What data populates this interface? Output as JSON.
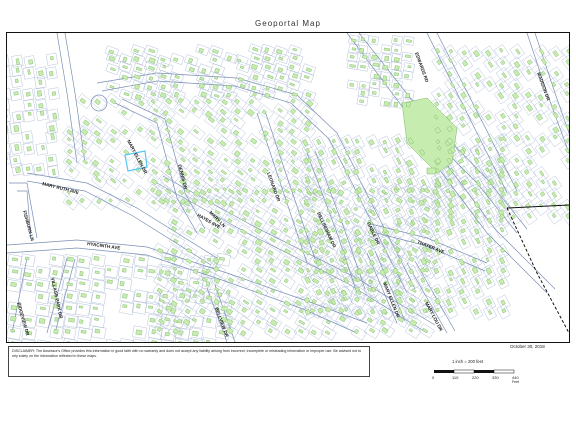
{
  "title": "Geoportal Map",
  "date": "October 30, 2018",
  "disclaimer": "DISCLAIMER: The Assessor's Office provides this information in good faith with no warranty and does not accept any liability arising from incorrect, incomplete or misleading information or improper use. Be advised not to rely solely on the information reflected in these maps.",
  "scale": {
    "text": "1 inch = 200 feet",
    "ticks": [
      "0",
      "110",
      "220",
      "330",
      "440"
    ],
    "unit": "Feet"
  },
  "streets": [
    {
      "key": "mary_ellen_dr",
      "name": "MARY ELLEN DR"
    },
    {
      "key": "dennis_dr",
      "name": "DENNIS DR"
    },
    {
      "key": "mary_ruth_ave",
      "name": "MARY RUTH AVE"
    },
    {
      "key": "fishburn_ln",
      "name": "FISHBURN LN"
    },
    {
      "key": "hyacinth_ave",
      "name": "HYACINTH AVE"
    },
    {
      "key": "leonard_dr",
      "name": "LEONARD DR"
    },
    {
      "key": "mary_ln",
      "name": "MARY LN"
    },
    {
      "key": "hayes_ave",
      "name": "HAYES AVE"
    },
    {
      "key": "village_park_dr",
      "name": "VILLAGE PARK DR"
    },
    {
      "key": "ridgeview_dr",
      "name": "RIDGEVIEW DR"
    },
    {
      "key": "bellview_dr",
      "name": "BELLVIEW DR"
    },
    {
      "key": "bellingham_dr",
      "name": "BELLINGHAM DR"
    },
    {
      "key": "gable_dr",
      "name": "GABLE DR"
    },
    {
      "key": "thayer_ave",
      "name": "THAYER AVE"
    },
    {
      "key": "mary_ellen_dr_2",
      "name": "MARY ELLEN DR"
    },
    {
      "key": "mary_lou_dr",
      "name": "MARY LOU DR"
    },
    {
      "key": "edwards_rd",
      "name": "EDWARDS RD"
    },
    {
      "key": "madison_dr",
      "name": "MADISON DR"
    }
  ]
}
